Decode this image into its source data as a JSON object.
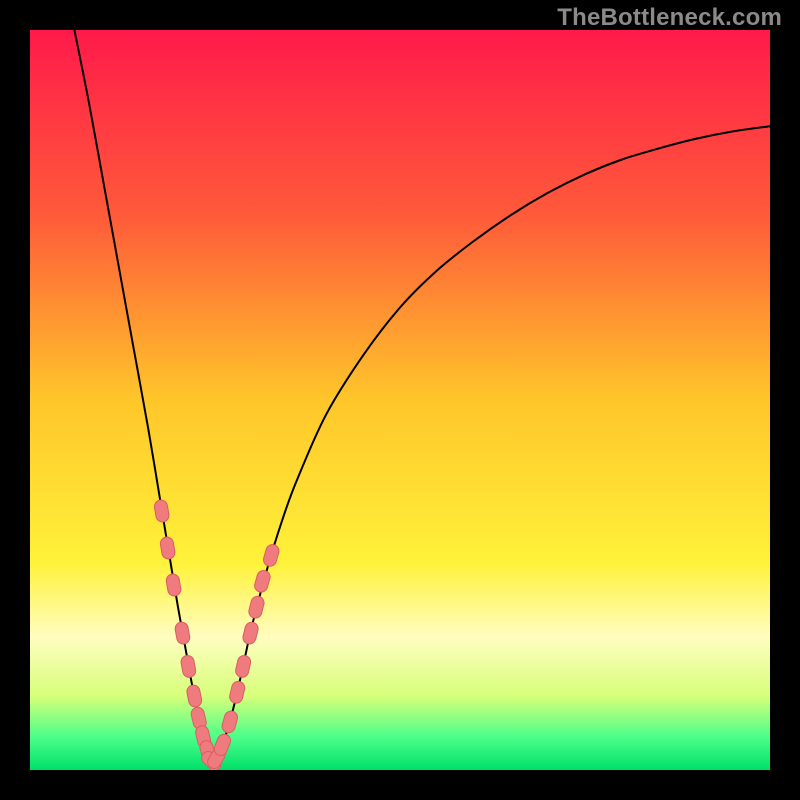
{
  "watermark": "TheBottleneck.com",
  "colors": {
    "frame": "#000000",
    "gradient_stops": [
      {
        "offset": 0.0,
        "color": "#ff1a4a"
      },
      {
        "offset": 0.25,
        "color": "#ff5a3a"
      },
      {
        "offset": 0.5,
        "color": "#ffc62a"
      },
      {
        "offset": 0.72,
        "color": "#fff23a"
      },
      {
        "offset": 0.82,
        "color": "#fffdc0"
      },
      {
        "offset": 0.9,
        "color": "#d7ff7a"
      },
      {
        "offset": 0.955,
        "color": "#4cff8a"
      },
      {
        "offset": 1.0,
        "color": "#00e06a"
      }
    ],
    "curve": "#000000",
    "marker_fill": "#ef7b7f",
    "marker_stroke": "#d85e62"
  },
  "chart_data": {
    "type": "line",
    "title": "",
    "xlabel": "",
    "ylabel": "",
    "xlim": [
      0,
      100
    ],
    "ylim": [
      0,
      100
    ],
    "x_optimum": 24.5,
    "series": [
      {
        "name": "bottleneck-curve",
        "x": [
          6,
          8,
          10,
          12,
          14,
          16,
          18,
          19,
          20,
          21,
          22,
          23,
          24,
          24.5,
          25,
          26,
          27,
          28,
          29,
          30,
          32,
          34,
          36,
          40,
          45,
          50,
          55,
          60,
          65,
          70,
          75,
          80,
          85,
          90,
          95,
          100
        ],
        "y": [
          100,
          90,
          79,
          68,
          57,
          46,
          34,
          28,
          22,
          16.5,
          11,
          6.5,
          2.5,
          1.0,
          1.5,
          3.5,
          6.5,
          10.5,
          15,
          19.5,
          27,
          33.5,
          39,
          48,
          56,
          62.5,
          67.5,
          71.5,
          75,
          78,
          80.5,
          82.5,
          84,
          85.3,
          86.3,
          87
        ]
      }
    ],
    "markers": [
      {
        "x": 17.8,
        "y": 35.0
      },
      {
        "x": 18.6,
        "y": 30.0
      },
      {
        "x": 19.4,
        "y": 25.0
      },
      {
        "x": 20.6,
        "y": 18.5
      },
      {
        "x": 21.4,
        "y": 14.0
      },
      {
        "x": 22.2,
        "y": 10.0
      },
      {
        "x": 22.8,
        "y": 7.0
      },
      {
        "x": 23.4,
        "y": 4.5
      },
      {
        "x": 24.0,
        "y": 2.5
      },
      {
        "x": 24.5,
        "y": 1.2
      },
      {
        "x": 25.2,
        "y": 1.6
      },
      {
        "x": 26.0,
        "y": 3.4
      },
      {
        "x": 27.0,
        "y": 6.5
      },
      {
        "x": 28.0,
        "y": 10.5
      },
      {
        "x": 28.8,
        "y": 14.0
      },
      {
        "x": 29.8,
        "y": 18.5
      },
      {
        "x": 30.6,
        "y": 22.0
      },
      {
        "x": 31.4,
        "y": 25.5
      },
      {
        "x": 32.6,
        "y": 29.0
      }
    ]
  }
}
